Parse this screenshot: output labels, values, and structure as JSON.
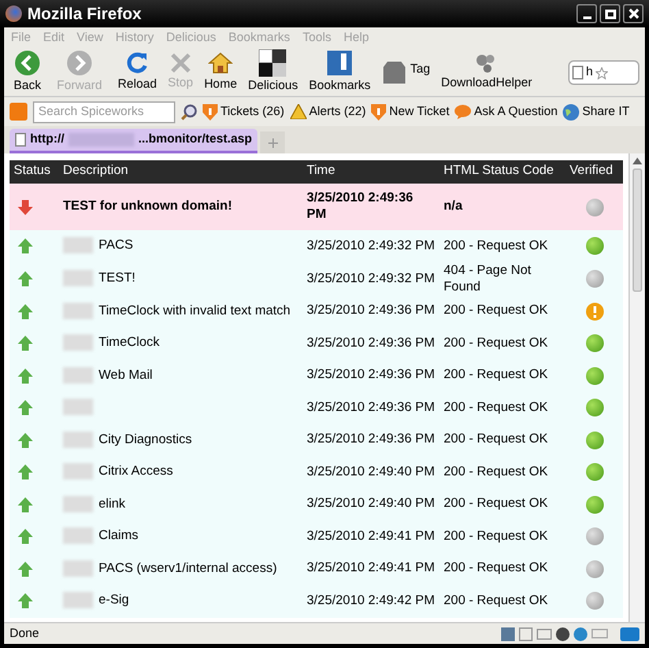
{
  "window": {
    "title": "Mozilla Firefox"
  },
  "menu": [
    "File",
    "Edit",
    "View",
    "History",
    "Delicious",
    "Bookmarks",
    "Tools",
    "Help"
  ],
  "toolbar": [
    {
      "label": "Back",
      "kind": "back",
      "disabled": false
    },
    {
      "label": "Forward",
      "kind": "forward",
      "disabled": true
    },
    {
      "label": "Reload",
      "kind": "reload",
      "disabled": false
    },
    {
      "label": "Stop",
      "kind": "stop",
      "disabled": true
    },
    {
      "label": "Home",
      "kind": "home",
      "disabled": false
    },
    {
      "label": "Delicious",
      "kind": "delicious",
      "disabled": false
    },
    {
      "label": "Bookmarks",
      "kind": "bookmarks",
      "disabled": false
    },
    {
      "label": "Tag",
      "kind": "tag",
      "disabled": false
    },
    {
      "label": "DownloadHelper",
      "kind": "download",
      "disabled": false
    }
  ],
  "address": {
    "value": "h"
  },
  "spiceworks": {
    "search_placeholder": "Search Spiceworks",
    "links": [
      {
        "label": "Tickets (26)",
        "kind": "ticket"
      },
      {
        "label": "Alerts (22)",
        "kind": "alert"
      },
      {
        "label": "New Ticket",
        "kind": "ticket"
      },
      {
        "label": "Ask A Question",
        "kind": "bubble"
      },
      {
        "label": "Share IT",
        "kind": "globe"
      }
    ]
  },
  "tab": {
    "title_start": "http://",
    "title_end": "...bmonitor/test.asp",
    "selected": true
  },
  "table": {
    "columns": [
      "Status",
      "Description",
      "Time",
      "HTML Status Code",
      "Verified"
    ],
    "rows": [
      {
        "down": true,
        "description": "TEST for unknown domain!",
        "time": "3/25/2010 2:49:36 PM",
        "code": "n/a",
        "verified": false,
        "warning": false
      },
      {
        "down": false,
        "description": "PACS",
        "redacted": true,
        "time": "3/25/2010 2:49:32 PM",
        "code": "200 - Request OK",
        "verified": true,
        "warning": false
      },
      {
        "down": false,
        "description": "TEST!",
        "redacted": true,
        "time": "3/25/2010 2:49:32 PM",
        "code": "404 - Page Not Found",
        "verified": false,
        "warning": false
      },
      {
        "down": false,
        "description": "TimeClock with invalid text match",
        "redacted": true,
        "time": "3/25/2010 2:49:36 PM",
        "code": "200 - Request OK",
        "verified": false,
        "warning": true
      },
      {
        "down": false,
        "description": "TimeClock",
        "redacted": true,
        "time": "3/25/2010 2:49:36 PM",
        "code": "200 - Request OK",
        "verified": true,
        "warning": false
      },
      {
        "down": false,
        "description": "Web Mail",
        "redacted": true,
        "time": "3/25/2010 2:49:36 PM",
        "code": "200 - Request OK",
        "verified": true,
        "warning": false
      },
      {
        "down": false,
        "redacted": true,
        "time": "3/25/2010 2:49:36 PM",
        "code": "200 - Request OK",
        "verified": true,
        "warning": false
      },
      {
        "down": false,
        "description": "City Diagnostics",
        "redacted": true,
        "time": "3/25/2010 2:49:36 PM",
        "code": "200 - Request OK",
        "verified": true,
        "warning": false
      },
      {
        "down": false,
        "description": "Citrix Access",
        "redacted": true,
        "time": "3/25/2010 2:49:40 PM",
        "code": "200 - Request OK",
        "verified": true,
        "warning": false
      },
      {
        "down": false,
        "description": "elink",
        "redacted": true,
        "time": "3/25/2010 2:49:40 PM",
        "code": "200 - Request OK",
        "verified": true,
        "warning": false
      },
      {
        "down": false,
        "description": "Claims",
        "redacted": true,
        "time": "3/25/2010 2:49:41 PM",
        "code": "200 - Request OK",
        "verified": false,
        "warning": false
      },
      {
        "down": false,
        "description": "PACS (wserv1/internal access)",
        "redacted": true,
        "time": "3/25/2010 2:49:41 PM",
        "code": "200 - Request OK",
        "verified": false,
        "warning": false
      },
      {
        "down": false,
        "description": "e-Sig",
        "redacted": true,
        "time": "3/25/2010 2:49:42 PM",
        "code": "200 - Request OK",
        "verified": false,
        "warning": false
      }
    ]
  },
  "status_bar": {
    "text": "Done"
  }
}
